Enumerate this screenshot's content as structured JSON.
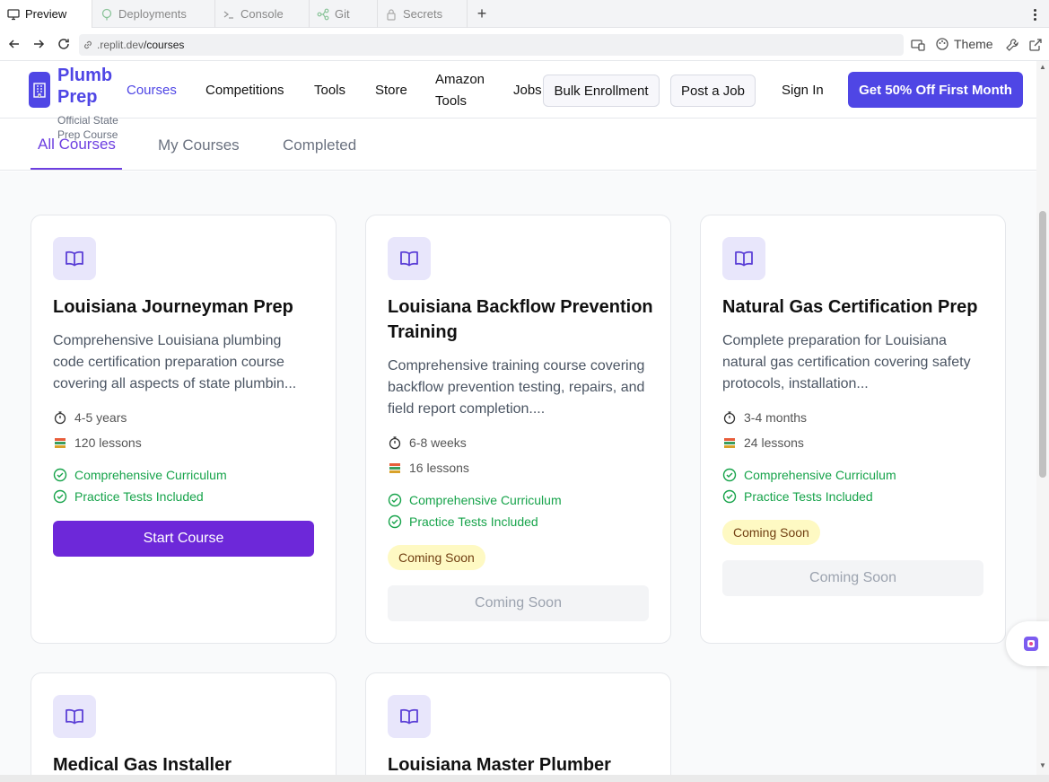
{
  "browser": {
    "tabs": [
      {
        "label": "Preview",
        "icon": "monitor-icon"
      },
      {
        "label": "Deployments",
        "icon": "deployments-icon"
      },
      {
        "label": "Console",
        "icon": "terminal-icon"
      },
      {
        "label": "Git",
        "icon": "git-icon"
      },
      {
        "label": "Secrets",
        "icon": "lock-icon"
      }
    ],
    "url_prefix": ".replit.dev",
    "url_path": "/courses",
    "theme_label": "Theme"
  },
  "header": {
    "brand_line1": "Plumb",
    "brand_line2": "Prep",
    "brand_subtitle": "Official State Prep Course",
    "nav": [
      "Courses",
      "Competitions",
      "Tools",
      "Store",
      "Amazon Tools",
      "Jobs"
    ],
    "active_nav": "Courses",
    "bulk_enrollment": "Bulk Enrollment",
    "post_job": "Post a Job",
    "sign_in": "Sign In",
    "cta": "Get 50% Off First Month"
  },
  "subtabs": [
    "All Courses",
    "My Courses",
    "Completed"
  ],
  "active_subtab": "All Courses",
  "courses": [
    {
      "title": "Louisiana Journeyman Prep",
      "description": "Comprehensive Louisiana plumbing code certification preparation course covering all aspects of state plumbin...",
      "duration": "4-5 years",
      "lessons": "120 lessons",
      "features": [
        "Comprehensive Curriculum",
        "Practice Tests Included"
      ],
      "badge": "",
      "button": "Start Course"
    },
    {
      "title": "Louisiana Backflow Prevention Training",
      "description": "Comprehensive training course covering backflow prevention testing, repairs, and field report completion....",
      "duration": "6-8 weeks",
      "lessons": "16 lessons",
      "features": [
        "Comprehensive Curriculum",
        "Practice Tests Included"
      ],
      "badge": "Coming Soon",
      "button": "Coming Soon"
    },
    {
      "title": "Natural Gas Certification Prep",
      "description": "Complete preparation for Louisiana natural gas certification covering safety protocols, installation...",
      "duration": "3-4 months",
      "lessons": "24 lessons",
      "features": [
        "Comprehensive Curriculum",
        "Practice Tests Included"
      ],
      "badge": "Coming Soon",
      "button": "Coming Soon"
    },
    {
      "title": "Medical Gas Installer"
    },
    {
      "title": "Louisiana Master Plumber"
    }
  ],
  "colors": {
    "brand": "#4f46e5",
    "accent_purple": "#6d28d9",
    "success": "#16a34a",
    "badge_bg": "#fef9c3"
  }
}
